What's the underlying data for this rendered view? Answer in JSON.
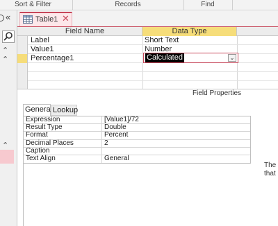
{
  "ribbon": {
    "groups": [
      "Sort & Filter",
      "Records",
      "Find"
    ]
  },
  "document_tab": {
    "title": "Table1",
    "icon": "table-icon"
  },
  "grid": {
    "headers": {
      "field_name": "Field Name",
      "data_type": "Data Type"
    },
    "rows": [
      {
        "field_name": "Label",
        "data_type": "Short Text"
      },
      {
        "field_name": "Value1",
        "data_type": "Number"
      },
      {
        "field_name": "Percentage1",
        "data_type": "Calculated"
      }
    ]
  },
  "field_properties": {
    "title": "Field Properties",
    "tabs": [
      "General",
      "Lookup"
    ],
    "properties": [
      {
        "name": "Expression",
        "value": "[Value1]/72"
      },
      {
        "name": "Result Type",
        "value": "Double"
      },
      {
        "name": "Format",
        "value": "Percent"
      },
      {
        "name": "Decimal Places",
        "value": "2"
      },
      {
        "name": "Caption",
        "value": ""
      },
      {
        "name": "Text Align",
        "value": "General"
      }
    ],
    "help_text": "The that"
  },
  "colors": {
    "accent": "#c7475a",
    "header_highlight": "#f6dd7a",
    "nav_highlight": "#f7c9cf"
  }
}
